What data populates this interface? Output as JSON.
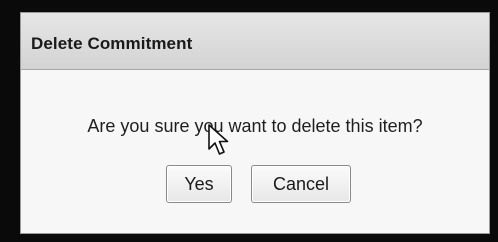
{
  "dialog": {
    "title": "Delete Commitment",
    "message": "Are you sure you want to delete this item?",
    "buttons": {
      "yes_label": "Yes",
      "cancel_label": "Cancel"
    }
  },
  "cursor": {
    "icon": "mouse-pointer-icon"
  }
}
